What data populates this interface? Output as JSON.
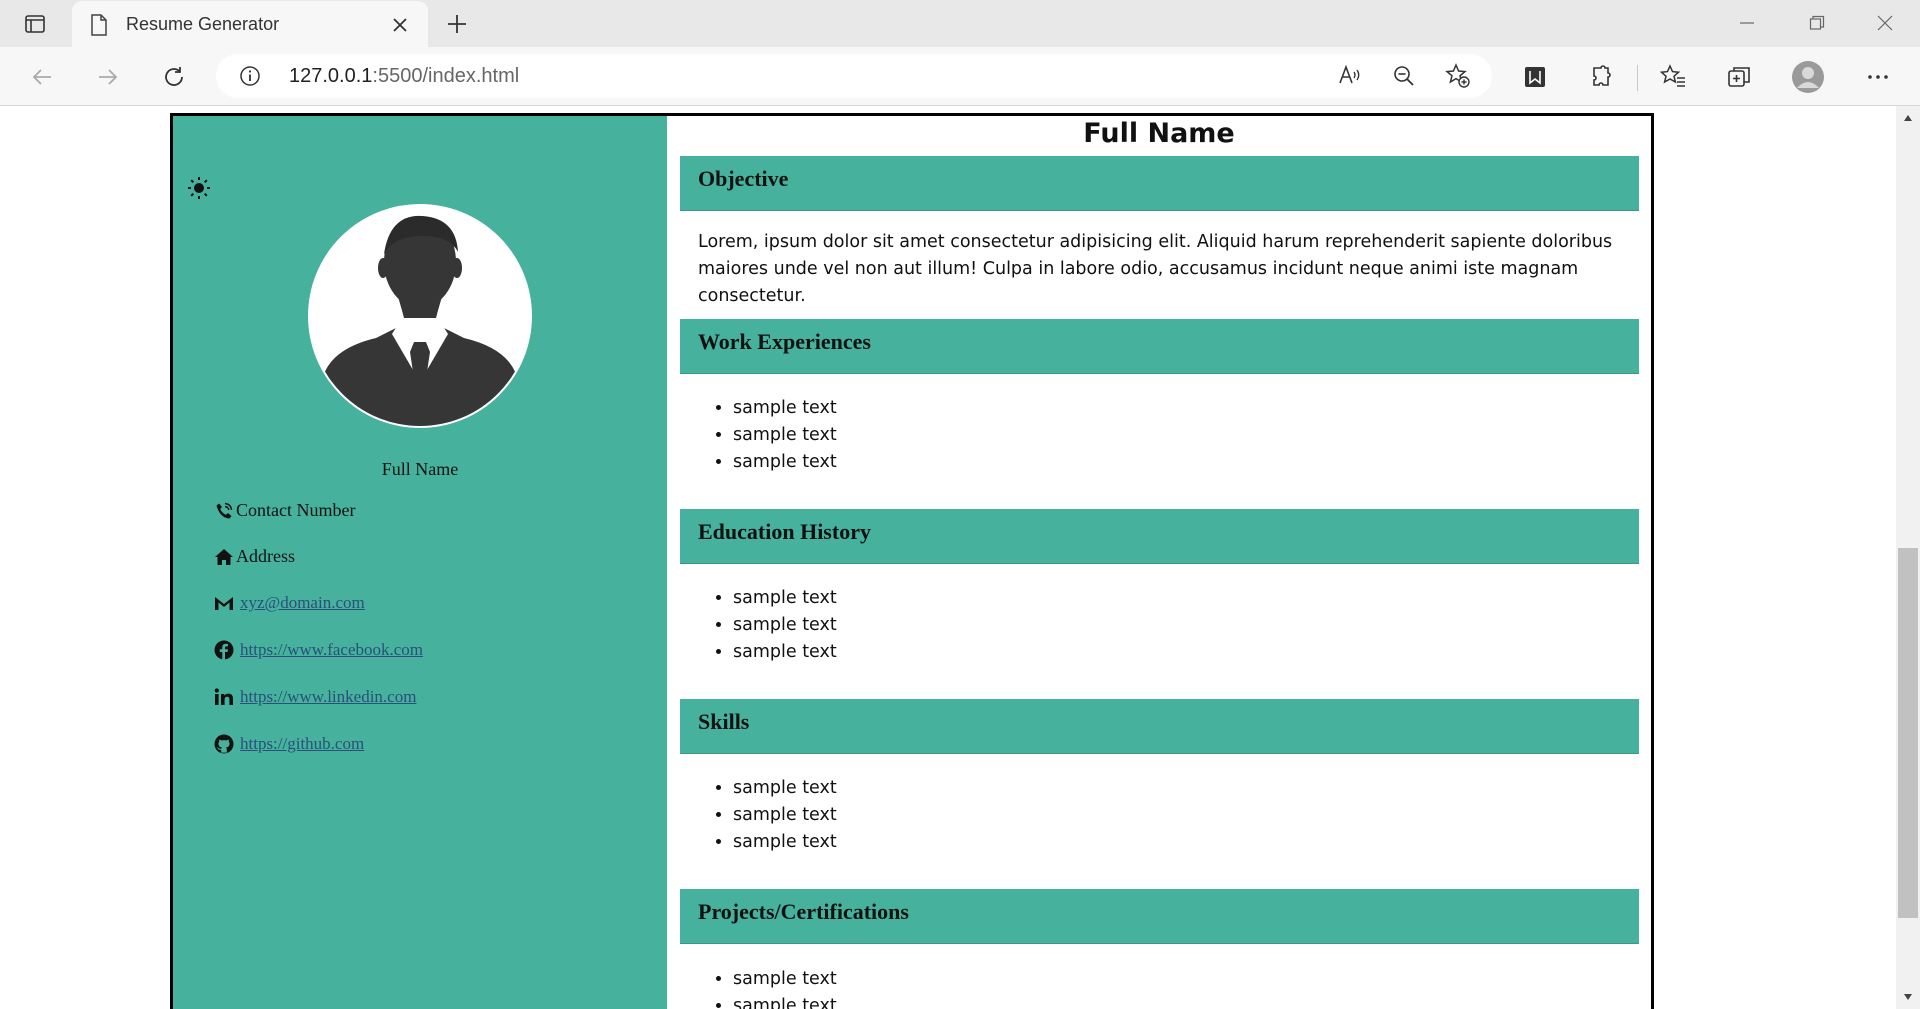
{
  "browser": {
    "tab_title": "Resume Generator",
    "url_host": "127.0.0.1",
    "url_rest": ":5500/index.html"
  },
  "sidebar": {
    "name": "Full Name",
    "contact_number": "Contact Number",
    "address": "Address",
    "email": "xyz@domain.com",
    "facebook": "https://www.facebook.com",
    "linkedin": "https://www.linkedin.com",
    "github": "https://github.com"
  },
  "main": {
    "full_name": "Full Name",
    "objective_title": "Objective",
    "objective_text": "Lorem, ipsum dolor sit amet consectetur adipisicing elit. Aliquid harum reprehenderit sapiente doloribus maiores unde vel non aut illum! Culpa in labore odio, accusamus incidunt neque animi iste magnam consectetur.",
    "work": {
      "title": "Work Experiences",
      "items": [
        "sample text",
        "sample text",
        "sample text"
      ]
    },
    "education": {
      "title": "Education History",
      "items": [
        "sample text",
        "sample text",
        "sample text"
      ]
    },
    "skills": {
      "title": "Skills",
      "items": [
        "sample text",
        "sample text",
        "sample text"
      ]
    },
    "projects": {
      "title": "Projects/Certifications",
      "items": [
        "sample text",
        "sample text"
      ]
    }
  },
  "colors": {
    "accent": "#46b29d",
    "link": "#2a4f7a"
  }
}
